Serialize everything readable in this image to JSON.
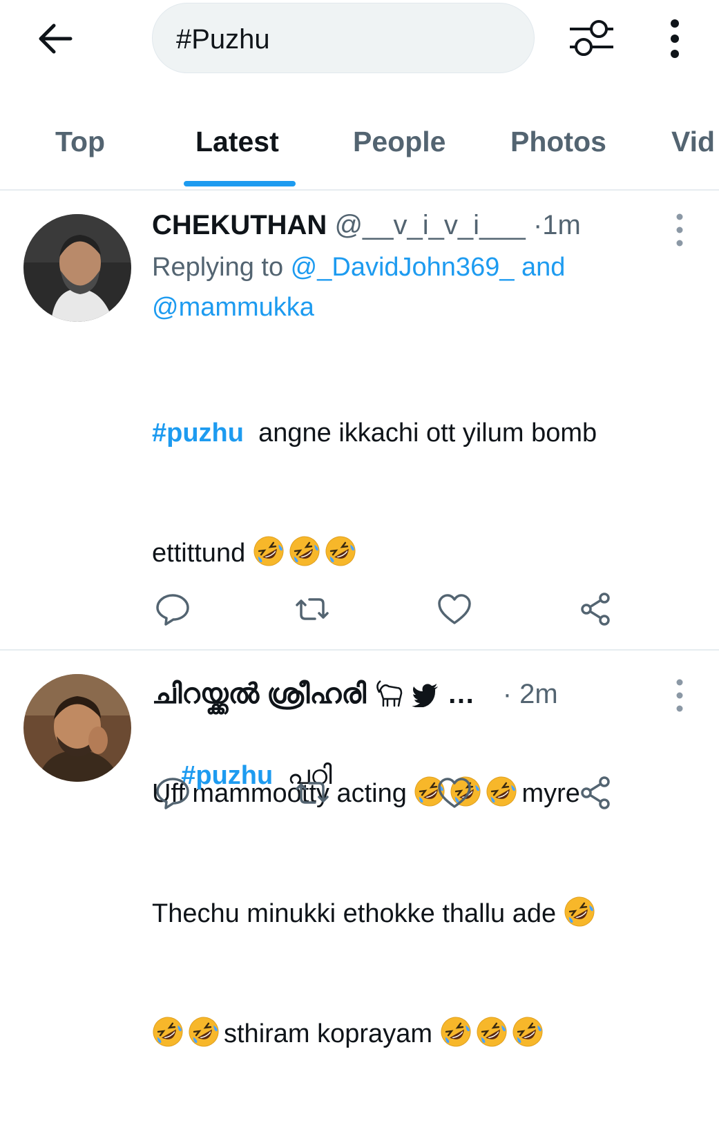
{
  "header": {
    "back_icon": "arrow-left-icon",
    "search_value": "#Puzhu",
    "filter_icon": "sliders-icon",
    "more_icon": "vertical-dots-icon"
  },
  "tabs": [
    {
      "label": "Top",
      "active": false
    },
    {
      "label": "Latest",
      "active": true
    },
    {
      "label": "People",
      "active": false
    },
    {
      "label": "Photos",
      "active": false
    },
    {
      "label": "Vid",
      "active": false
    }
  ],
  "tweets": [
    {
      "display_name": "CHEKUTHAN",
      "handle": "@__v_i_v_i___",
      "separator": "·",
      "time": "1m",
      "replying_prefix": "Replying to ",
      "replying_mention_1": "@_DavidJohn369_",
      "replying_and": " and",
      "replying_mention_2": "@mammukka",
      "hashtag": "#puzhu",
      "line1_text": "  angne ikkachi ott yilum bomb",
      "line2_text": "ettittund ",
      "line4_text": "Uff mammootty acting ",
      "line4_tail": "myre",
      "line5_text": "Thechu minukki ethokke thallu ade ",
      "line6_text": "sthiram koprayam ",
      "emoji_name": "rolling-on-floor-laughing"
    },
    {
      "display_name": "ചിറയ്ക്കൽ ശ്രീഹരി",
      "name_suffix": "…",
      "separator": "·",
      "time": "2m",
      "hashtag": "#puzhu",
      "text": "  പറി",
      "name_icons": [
        "goat-icon",
        "twitter-bird-icon"
      ]
    }
  ],
  "actions": [
    "reply-icon",
    "retweet-icon",
    "like-icon",
    "share-icon"
  ],
  "colors": {
    "accent": "#1d9bf0",
    "muted": "#536471",
    "text": "#0f1419",
    "emoji_face": "#f7b72a"
  }
}
